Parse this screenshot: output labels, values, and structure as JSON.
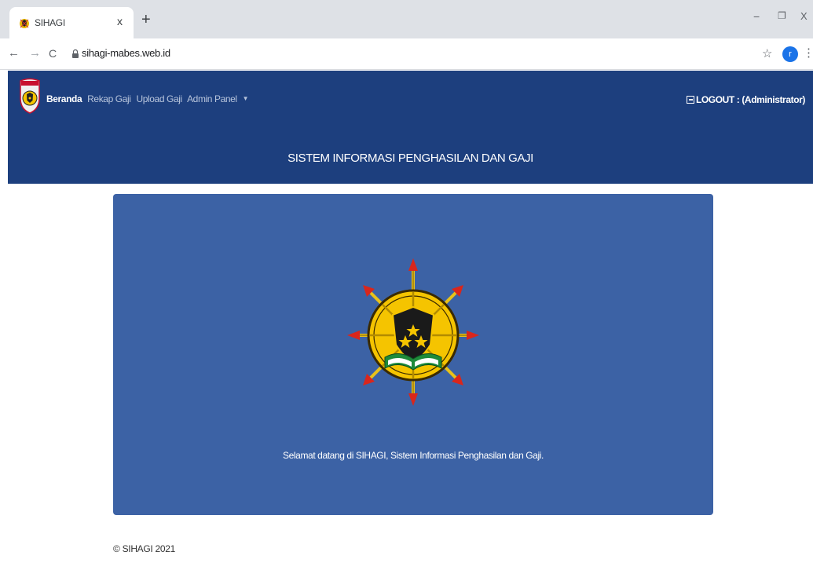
{
  "browser": {
    "tab_title": "SIHAGI",
    "tab_close": "x",
    "new_tab": "+",
    "url": "sihagi-mabes.web.id",
    "profile_initial": "r",
    "window_controls": {
      "minimize": "−",
      "restore": "❐",
      "close": "X"
    },
    "icons": {
      "back": "←",
      "forward": "→",
      "reload": "C",
      "star": "☆",
      "menu": "⋮"
    }
  },
  "header": {
    "nav": [
      {
        "label": "Beranda",
        "active": true
      },
      {
        "label": "Rekap Gaji",
        "active": false
      },
      {
        "label": "Upload Gaji",
        "active": false
      },
      {
        "label": "Admin Panel",
        "active": false
      }
    ],
    "admin_caret": "▼",
    "logout_label": "LOGOUT : (Administrator)",
    "title": "SISTEM INFORMASI PENGHASILAN DAN GAJI"
  },
  "main": {
    "welcome_text": "Selamat datang di SIHAGI, Sistem Informasi Penghasilan dan Gaji."
  },
  "footer": {
    "copyright": "© SIHAGI 2021"
  },
  "colors": {
    "header_bg": "#1d3f7e",
    "card_bg": "#3c62a5",
    "emblem_gold": "#f5c400",
    "arrow_red": "#d9261c"
  }
}
